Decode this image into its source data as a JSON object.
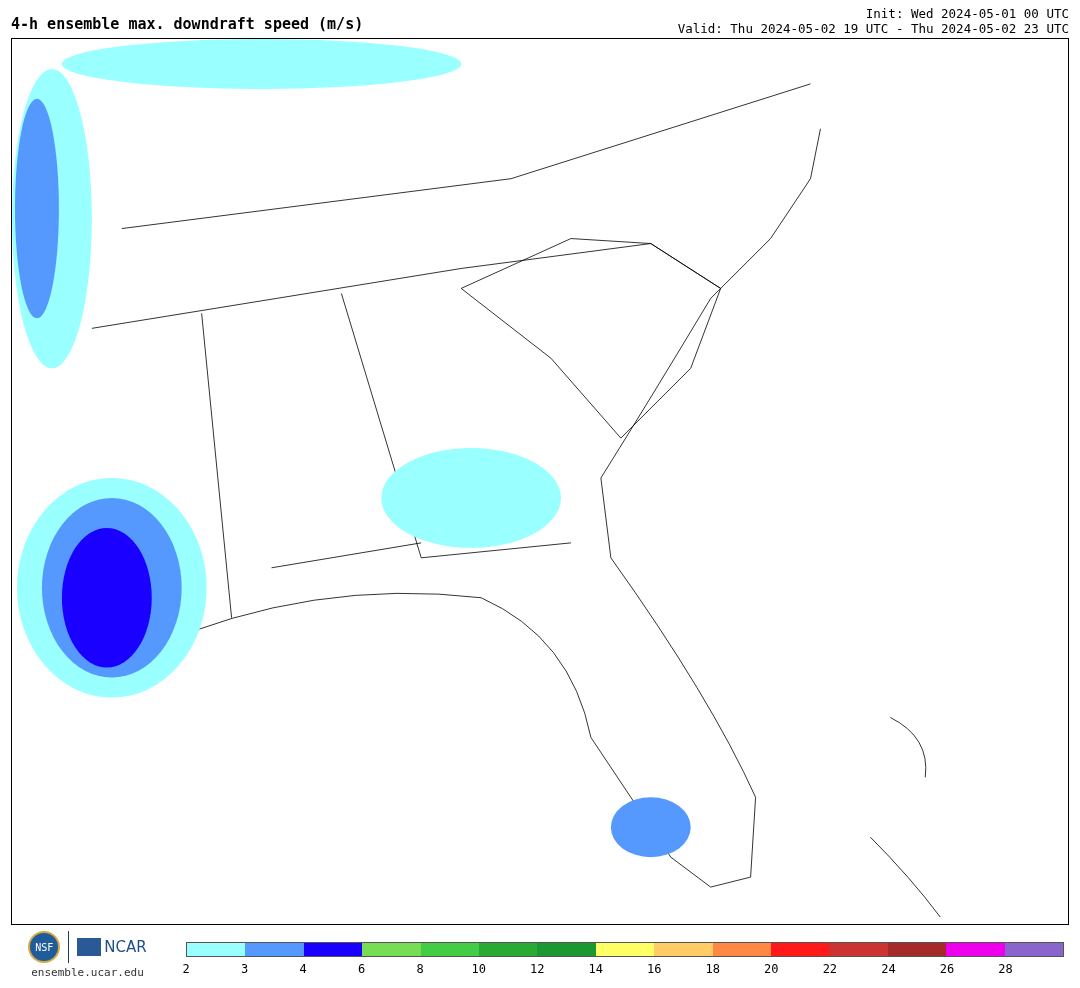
{
  "title": "4-h ensemble max. downdraft speed (m/s)",
  "init": "Init: Wed 2024-05-01 00 UTC",
  "valid": "Valid: Thu 2024-05-02 19 UTC - Thu 2024-05-02 23 UTC",
  "logos": {
    "nsf": "NSF",
    "ncar": "NCAR",
    "url": "ensemble.ucar.edu"
  },
  "legend": {
    "segments": [
      {
        "color": "#99ffff"
      },
      {
        "color": "#5599ff"
      },
      {
        "color": "#1a00ff"
      },
      {
        "color": "#77dd55"
      },
      {
        "color": "#44cc44"
      },
      {
        "color": "#2aaa33"
      },
      {
        "color": "#1a9933"
      },
      {
        "color": "#ffff66"
      },
      {
        "color": "#ffcc66"
      },
      {
        "color": "#ff8844"
      },
      {
        "color": "#ff1a1a"
      },
      {
        "color": "#cc3333"
      },
      {
        "color": "#a52a2a"
      },
      {
        "color": "#ee00ee"
      },
      {
        "color": "#8866cc"
      }
    ],
    "ticks": [
      "2",
      "3",
      "4",
      "6",
      "8",
      "10",
      "12",
      "14",
      "16",
      "18",
      "20",
      "22",
      "24",
      "26",
      "28"
    ]
  }
}
